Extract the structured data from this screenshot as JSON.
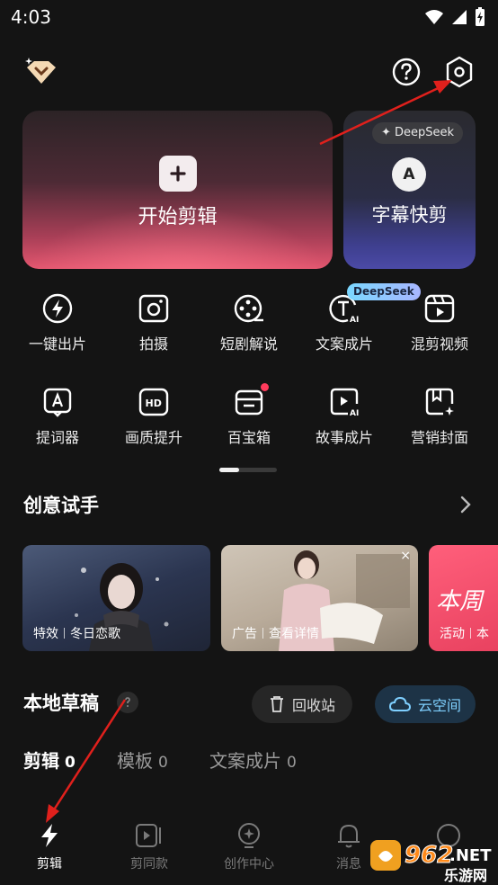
{
  "status": {
    "time": "4:03"
  },
  "cards": {
    "main_label": "开始剪辑",
    "sub_badge": "DeepSeek",
    "sub_label": "字幕快剪"
  },
  "tools_row1": [
    {
      "label": "一键出片",
      "icon": "lightning-circle-icon"
    },
    {
      "label": "拍摄",
      "icon": "camera-icon"
    },
    {
      "label": "短剧解说",
      "icon": "film-reel-icon"
    },
    {
      "label": "文案成片",
      "icon": "text-ai-icon",
      "badge": "DeepSeek"
    },
    {
      "label": "混剪视频",
      "icon": "video-clip-icon"
    }
  ],
  "tools_row2": [
    {
      "label": "提词器",
      "icon": "teleprompter-icon"
    },
    {
      "label": "画质提升",
      "icon": "hd-icon"
    },
    {
      "label": "百宝箱",
      "icon": "toolbox-icon"
    },
    {
      "label": "故事成片",
      "icon": "story-ai-icon"
    },
    {
      "label": "营销封面",
      "icon": "cover-icon"
    }
  ],
  "creative": {
    "title": "创意试手",
    "banners": [
      {
        "tag1": "特效",
        "tag2": "冬日恋歌"
      },
      {
        "tag1": "广告",
        "tag2": "查看详情",
        "close": "×"
      },
      {
        "tag1": "活动",
        "tag2": "本",
        "overlay": "本周"
      }
    ]
  },
  "drafts": {
    "title": "本地草稿",
    "recycle_label": "回收站",
    "cloud_label": "云空间",
    "tabs": [
      {
        "label": "剪辑",
        "count": "0"
      },
      {
        "label": "模板",
        "count": "0"
      },
      {
        "label": "文案成片",
        "count": "0"
      }
    ]
  },
  "nav": [
    {
      "label": "剪辑",
      "icon": "bolt-icon"
    },
    {
      "label": "剪同款",
      "icon": "template-video-icon"
    },
    {
      "label": "创作中心",
      "icon": "bulb-icon"
    },
    {
      "label": "消息",
      "icon": "bell-icon"
    }
  ],
  "watermark": {
    "top": "962",
    "suffix": ".NET",
    "sub": "乐游网"
  },
  "colors": {
    "accent_pink": "#e3566f",
    "cloud_blue": "#7fd0ff",
    "annotation_red": "#e0201c"
  }
}
